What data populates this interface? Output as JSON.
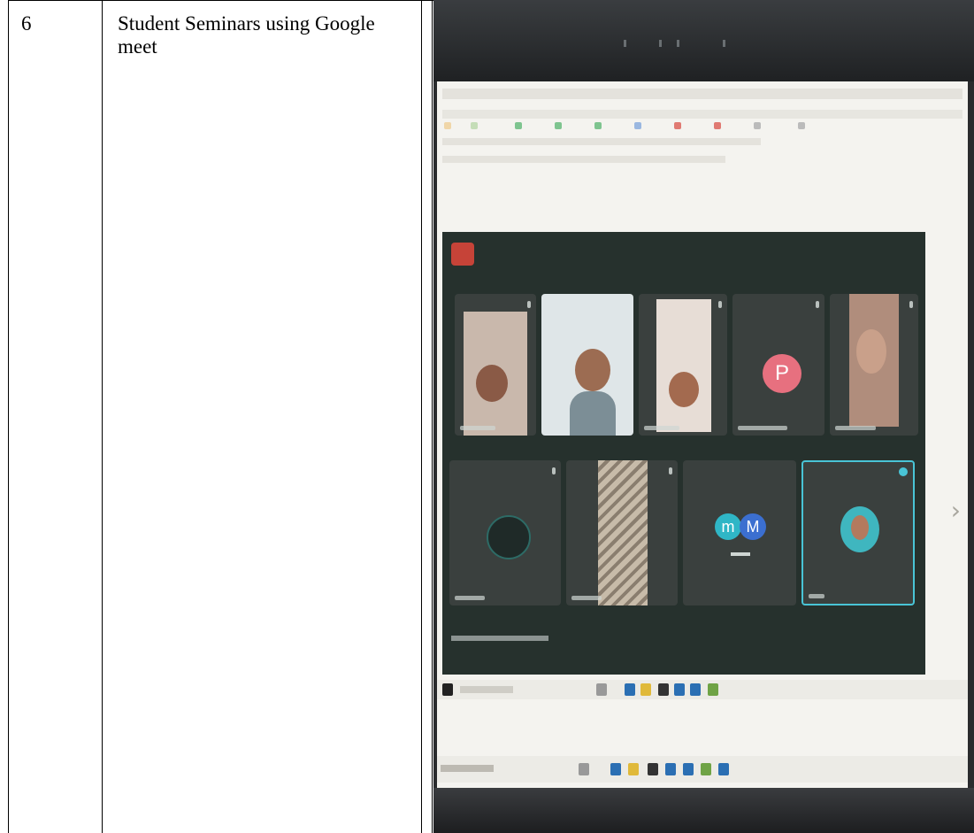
{
  "row": {
    "number": "6",
    "title": "Student Seminars using Google meet"
  },
  "photo": {
    "meet": {
      "tiles_row1": [
        "video",
        "video",
        "video",
        "avatar",
        "video"
      ],
      "avatar_letter": "P",
      "group_letters": [
        "m",
        "M"
      ]
    },
    "icons": {
      "record": "record-icon",
      "mic": "mic-icon",
      "end_call": "end-call-icon"
    },
    "colors": {
      "meet_bg": "#26312d",
      "end_call": "#d04437",
      "avatar_p": "#e7707f",
      "avatar_m1": "#2fb6c6",
      "avatar_m2": "#3b6fd0",
      "active_border": "#49c4d6"
    }
  }
}
